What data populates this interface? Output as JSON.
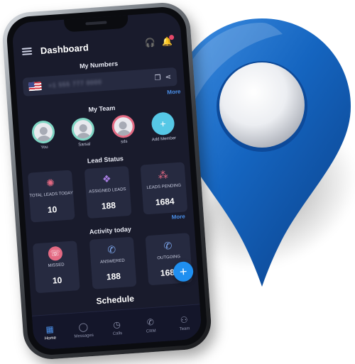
{
  "header": {
    "title": "Dashboard"
  },
  "my_numbers": {
    "label": "My Numbers",
    "number": "+1 555 777 0000",
    "more": "More"
  },
  "team": {
    "label": "My Team",
    "members": [
      {
        "name": "You"
      },
      {
        "name": "Sarsal"
      },
      {
        "name": "sds"
      },
      {
        "name": "Add Member"
      }
    ]
  },
  "lead_status": {
    "label": "Lead Status",
    "cards": [
      {
        "label": "TOTAL LEADS TODAY",
        "value": "10"
      },
      {
        "label": "ASSIGNED LEADS",
        "value": "188"
      },
      {
        "label": "LEADS PENDING",
        "value": "1684"
      }
    ]
  },
  "activity": {
    "label": "Activity today",
    "more": "More",
    "cards": [
      {
        "label": "MISSED",
        "value": "10"
      },
      {
        "label": "ANSWERED",
        "value": "188"
      },
      {
        "label": "OUTGOING",
        "value": "1684"
      }
    ]
  },
  "schedule": {
    "label": "Schedule"
  },
  "nav": {
    "items": [
      {
        "label": "Home"
      },
      {
        "label": "Messages"
      },
      {
        "label": "Calls"
      },
      {
        "label": "CRM"
      },
      {
        "label": "Team"
      }
    ]
  },
  "colors": {
    "screen_bg": "#191b2c",
    "card_bg": "#262a40",
    "accent": "#1f8ff0",
    "pin_blue": "#1565c0"
  },
  "icons": [
    "menu-icon",
    "headset-icon",
    "bell-icon",
    "copy-icon",
    "share-icon",
    "plus-icon",
    "home-icon",
    "message-icon",
    "clock-icon",
    "phone-icon",
    "team-icon",
    "location-pin-icon"
  ]
}
